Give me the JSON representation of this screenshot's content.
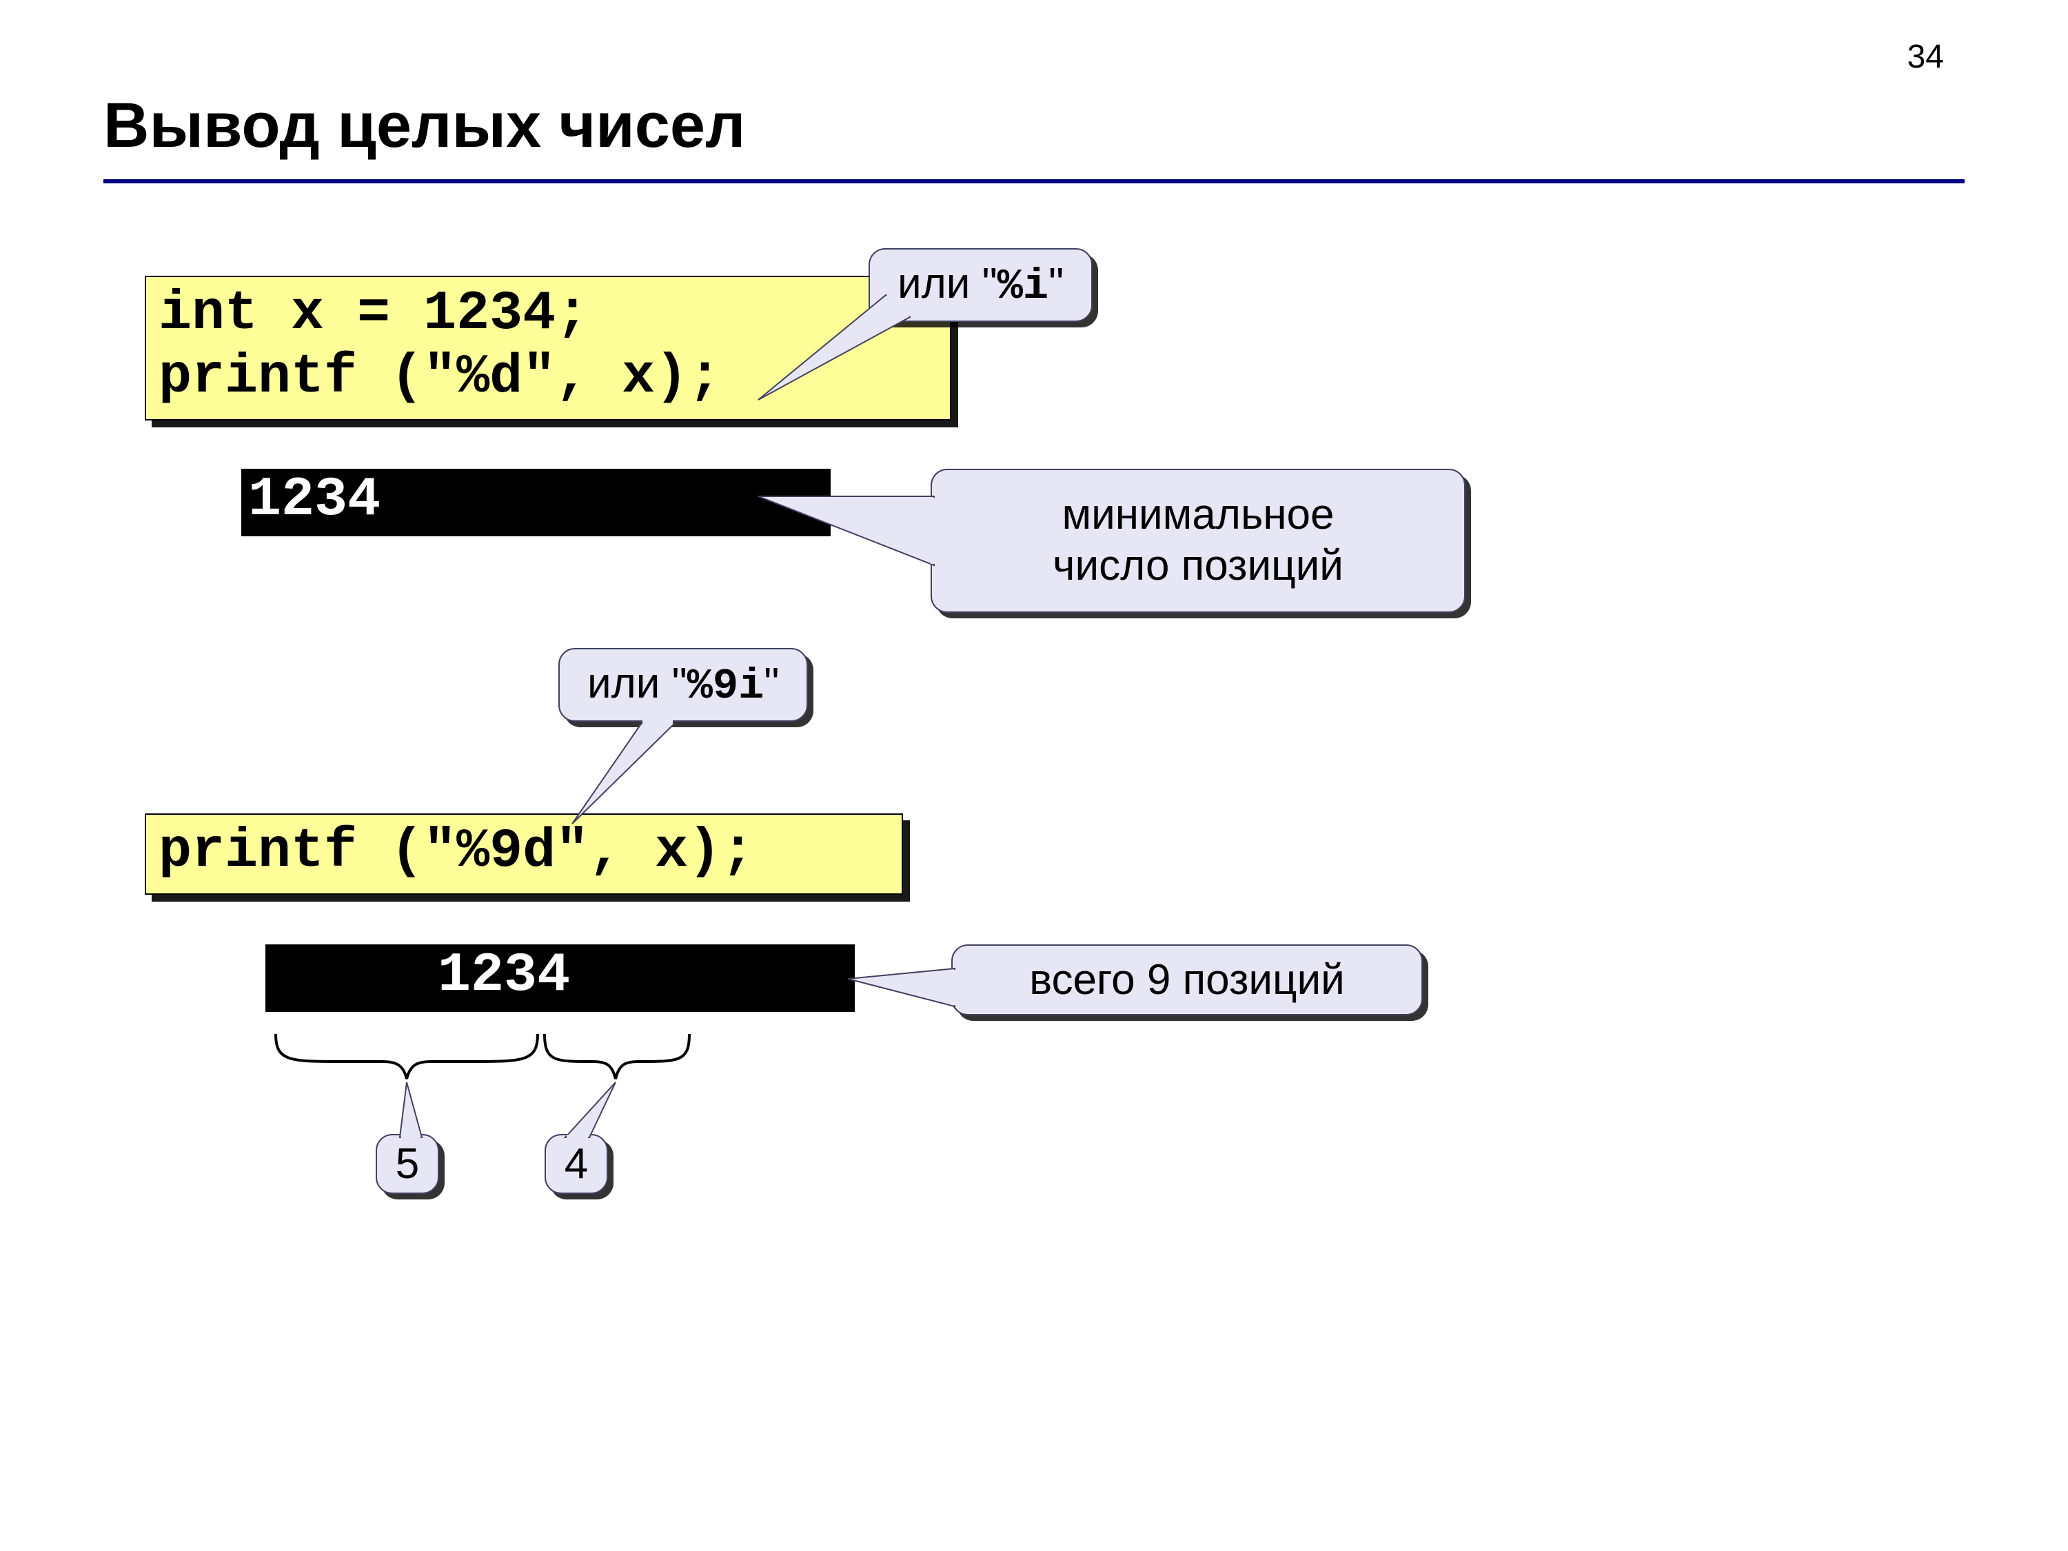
{
  "page_number": "34",
  "title": "Вывод целых чисел",
  "code_block_1_line1": "int x = 1234;",
  "code_block_1_line2": "printf (\"%d\", x);",
  "console_1": "1234",
  "callout_i_prefix": "или \"",
  "callout_i_code": "%i",
  "callout_i_suffix": "\"",
  "callout_minpos_line1": "минимальное",
  "callout_minpos_line2": "число позиций",
  "callout_9i_prefix": "или \"",
  "callout_9i_code": "%9i",
  "callout_9i_suffix": "\"",
  "code_block_2": "printf (\"%9d\", x);",
  "console_2": "     1234",
  "callout_9pos": "всего 9 позиций",
  "brace_left": "5",
  "brace_right": "4"
}
